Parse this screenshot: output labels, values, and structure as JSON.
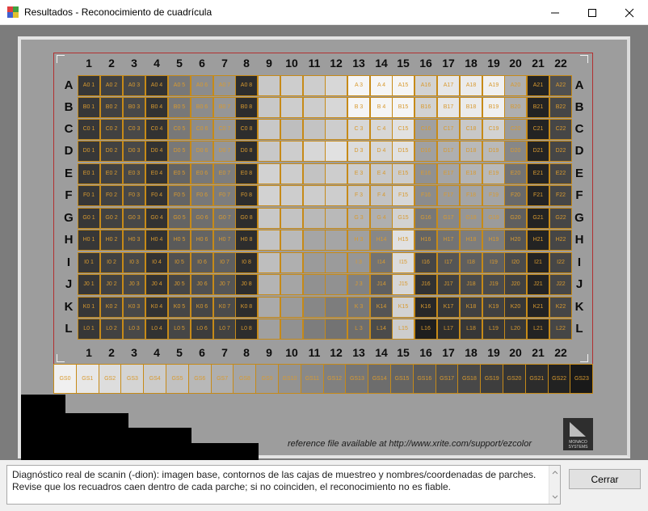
{
  "window": {
    "title": "Resultados - Reconocimiento de cuadrícula",
    "icon": "color-chart-icon"
  },
  "target": {
    "columns": [
      "1",
      "2",
      "3",
      "4",
      "5",
      "6",
      "7",
      "8",
      "9",
      "10",
      "11",
      "12",
      "13",
      "14",
      "15",
      "16",
      "17",
      "18",
      "19",
      "20",
      "21",
      "22"
    ],
    "rows": [
      "A",
      "B",
      "C",
      "D",
      "E",
      "F",
      "G",
      "H",
      "I",
      "J",
      "K",
      "L"
    ],
    "patch_labels": {
      "A": [
        "A0 1",
        "A0 2",
        "A0 3",
        "A0 4",
        "A0 5",
        "A0 6",
        "A0 7",
        "A0 8",
        "",
        "",
        "",
        "",
        "A 3",
        "A 4",
        "A15",
        "A16",
        "A17",
        "A18",
        "A19",
        "A20",
        "A21",
        "A22"
      ],
      "B": [
        "B0 1",
        "B0 2",
        "B0 3",
        "B0 4",
        "B0 5",
        "B0 6",
        "B0 7",
        "B0 8",
        "",
        "",
        "",
        "",
        "B 3",
        "B 4",
        "B15",
        "B16",
        "B17",
        "B18",
        "B19",
        "B20",
        "B21",
        "B22"
      ],
      "C": [
        "C0 1",
        "C0 2",
        "C0 3",
        "C0 4",
        "C0 5",
        "C0 6",
        "C0 7",
        "C0 8",
        "",
        "",
        "",
        "",
        "C 3",
        "C 4",
        "C15",
        "C16",
        "C17",
        "C18",
        "C19",
        "C20",
        "C21",
        "C22"
      ],
      "D": [
        "D0 1",
        "D0 2",
        "D0 3",
        "D0 4",
        "D0 5",
        "D0 6",
        "D0 7",
        "D0 8",
        "",
        "",
        "",
        "",
        "D 3",
        "D 4",
        "D15",
        "D16",
        "D17",
        "D18",
        "D19",
        "D20",
        "D21",
        "D22"
      ],
      "E": [
        "E0 1",
        "E0 2",
        "E0 3",
        "E0 4",
        "E0 5",
        "E0 6",
        "E0 7",
        "E0 8",
        "",
        "",
        "",
        "",
        "E 3",
        "E 4",
        "E15",
        "E16",
        "E17",
        "E18",
        "E19",
        "E20",
        "E21",
        "E22"
      ],
      "F": [
        "F0 1",
        "F0 2",
        "F0 3",
        "F0 4",
        "F0 5",
        "F0 6",
        "F0 7",
        "F0 8",
        "",
        "",
        "",
        "",
        "F 3",
        "F 4",
        "F15",
        "F16",
        "F17",
        "F18",
        "F19",
        "F20",
        "F21",
        "F22"
      ],
      "G": [
        "G0 1",
        "G0 2",
        "G0 3",
        "G0 4",
        "G0 5",
        "G0 6",
        "G0 7",
        "G0 8",
        "",
        "",
        "",
        "",
        "G 3",
        "G 4",
        "G15",
        "G16",
        "G17",
        "G18",
        "G19",
        "G20",
        "G21",
        "G22"
      ],
      "H": [
        "H0 1",
        "H0 2",
        "H0 3",
        "H0 4",
        "H0 5",
        "H0 6",
        "H0 7",
        "H0 8",
        "",
        "",
        "",
        "",
        "H 3",
        "H14",
        "H15",
        "H16",
        "H17",
        "H18",
        "H19",
        "H20",
        "H21",
        "H22"
      ],
      "I": [
        "I0 1",
        "I0 2",
        "I0 3",
        "I0 4",
        "I0 5",
        "I0 6",
        "I0 7",
        "I0 8",
        "",
        "",
        "",
        "",
        "I 3",
        "I14",
        "I15",
        "I16",
        "I17",
        "I18",
        "I19",
        "I20",
        "I21",
        "I22"
      ],
      "J": [
        "J0 1",
        "J0 2",
        "J0 3",
        "J0 4",
        "J0 5",
        "J0 6",
        "J0 7",
        "J0 8",
        "",
        "",
        "",
        "",
        "J 3",
        "J14",
        "J15",
        "J16",
        "J17",
        "J18",
        "J19",
        "J20",
        "J21",
        "J22"
      ],
      "K": [
        "K0 1",
        "K0 2",
        "K0 3",
        "K0 4",
        "K0 5",
        "K0 6",
        "K0 7",
        "K0 8",
        "",
        "",
        "",
        "",
        "K 3",
        "K14",
        "K15",
        "K16",
        "K17",
        "K18",
        "K19",
        "K20",
        "K21",
        "K22"
      ],
      "L": [
        "L0 1",
        "L0 2",
        "L0 3",
        "L0 4",
        "L0 5",
        "L0 6",
        "L0 7",
        "L0 8",
        "",
        "",
        "",
        "",
        "L 3",
        "L14",
        "L15",
        "L16",
        "L17",
        "L18",
        "L19",
        "L20",
        "L21",
        "L22"
      ]
    },
    "grayscale_labels": [
      "GS0",
      "GS1",
      "GS2",
      "GS3",
      "GS4",
      "GS5",
      "GS6",
      "GS7",
      "GS8",
      "GS9",
      "GS10",
      "GS11",
      "GS12",
      "GS13",
      "GS14",
      "GS15",
      "GS16",
      "GS17",
      "GS18",
      "GS19",
      "GS20",
      "GS21",
      "GS22",
      "GS23"
    ],
    "reference_note": "reference file available at http://www.xrite.com/support/ezcolor",
    "logo_text": "MONACO SYSTEMS",
    "colors": {
      "box_outline": "#c68a18",
      "frame_outline": "#b23030"
    }
  },
  "diagnostic": {
    "line1": "Diagnóstico real de scanin (-dion): imagen base, contornos de las cajas de muestreo y nombres/coordenadas de parches.",
    "line2": "Revise que los recuadros caen dentro de cada parche; si no coinciden, el reconocimiento no es fiable."
  },
  "buttons": {
    "close": "Cerrar"
  }
}
